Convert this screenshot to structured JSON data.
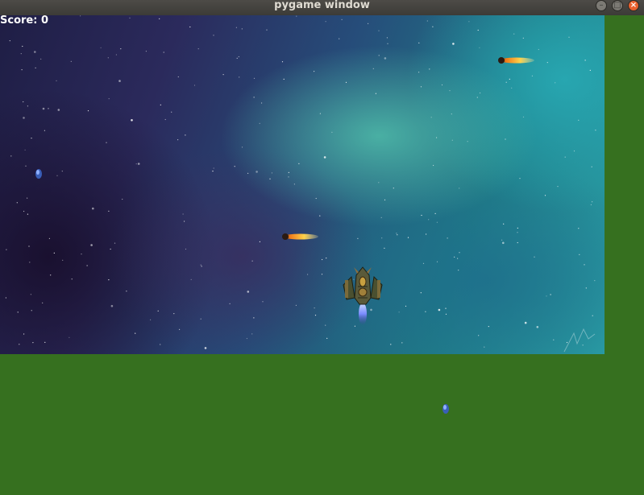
{
  "window": {
    "title": "pygame window",
    "buttons": {
      "minimize_glyph": "–",
      "maximize_glyph": "□",
      "close_glyph": "×"
    }
  },
  "hud": {
    "score_text": "Score: 0"
  },
  "colors": {
    "window_fill": "#36701f",
    "titlebar": "#3c3b37",
    "close_button": "#e9602e",
    "bullet_glow": "#f5b43a",
    "gem_blue": "#5a86e0"
  },
  "sprites": {
    "player": "spaceship-icon",
    "projectiles": [
      "fireball-icon",
      "fireball-icon"
    ],
    "pickups": [
      "blue-gem-icon",
      "blue-gem-icon"
    ]
  }
}
